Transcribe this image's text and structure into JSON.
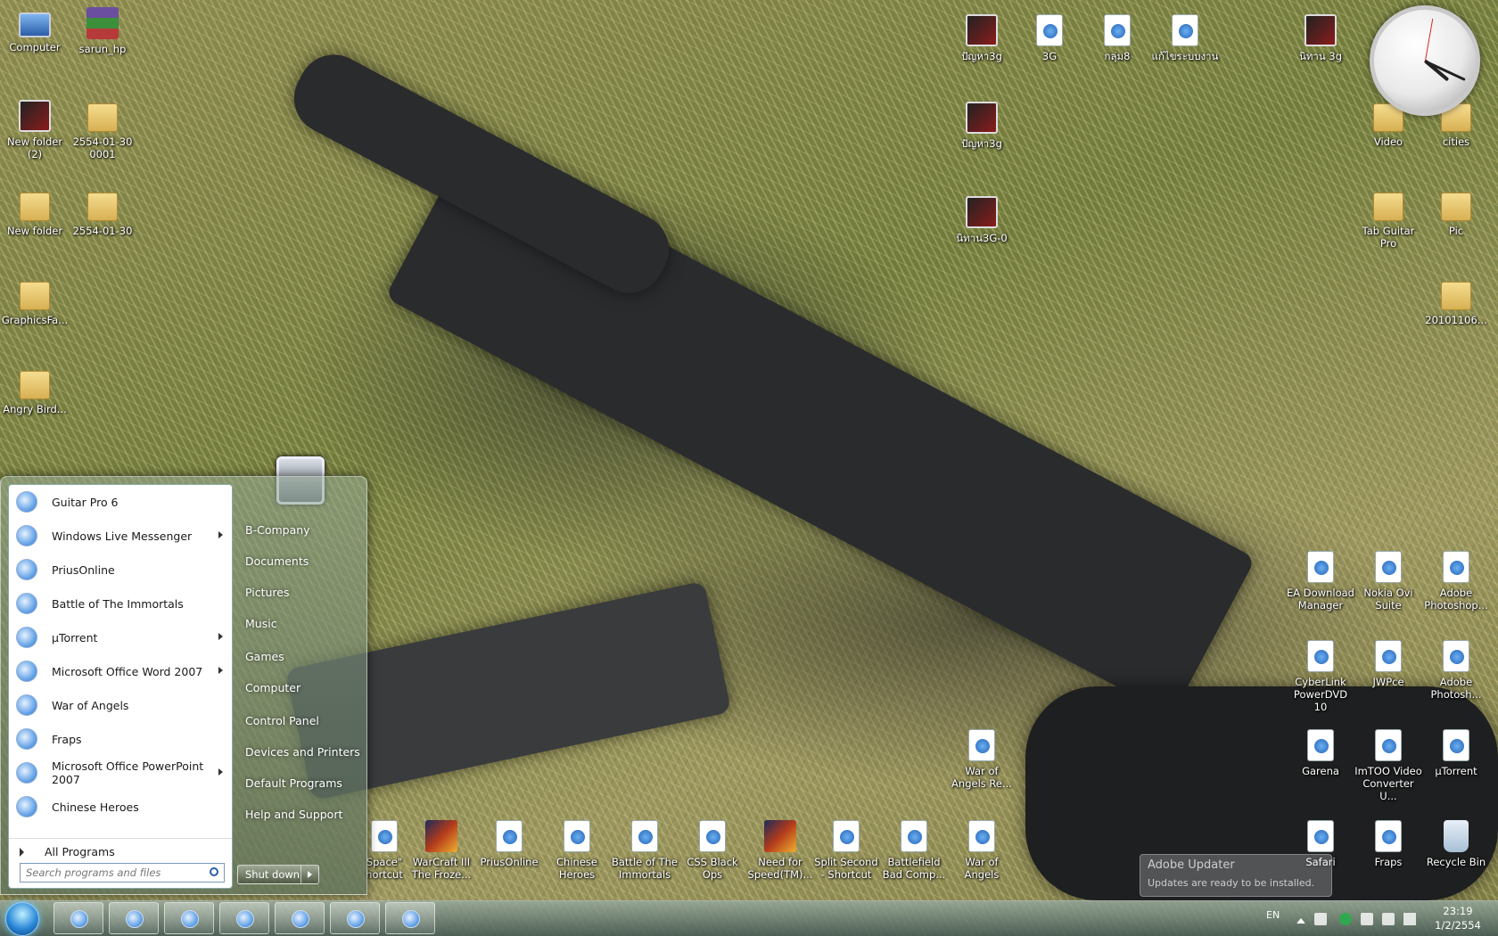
{
  "desktop": {
    "icons_left": [
      {
        "label": "Computer",
        "icon": "computer-icon"
      },
      {
        "label": "sarun_hp",
        "icon": "winrar-archive-icon"
      },
      {
        "label": "New folder (2)",
        "icon": "image-thumbnail-icon"
      },
      {
        "label": "2554-01-30 0001",
        "icon": "folder-icon"
      },
      {
        "label": "New folder",
        "icon": "folder-icon"
      },
      {
        "label": "2554-01-30",
        "icon": "folder-icon"
      },
      {
        "label": "GraphicsFa...",
        "icon": "folder-icon"
      },
      {
        "label": "Angry Bird...",
        "icon": "folder-icon"
      }
    ],
    "icons_top": [
      {
        "label": "ปัญหา3g",
        "icon": "image-thumbnail-icon"
      },
      {
        "label": "3G",
        "icon": "document-icon"
      },
      {
        "label": "กลุ่ม8",
        "icon": "document-icon"
      },
      {
        "label": "แก้ไขระบบงาน",
        "icon": "document-icon"
      },
      {
        "label": "นิทาน 3g",
        "icon": "image-thumbnail-icon"
      },
      {
        "label": "ปัญหา3g",
        "icon": "image-thumbnail-icon"
      },
      {
        "label": "นิทาน3G-0",
        "icon": "image-thumbnail-icon"
      }
    ],
    "icons_right": [
      {
        "label": "Video",
        "icon": "folder-icon"
      },
      {
        "label": "cities",
        "icon": "folder-icon"
      },
      {
        "label": "Tab Guitar Pro",
        "icon": "folder-icon"
      },
      {
        "label": "Pic",
        "icon": "folder-icon"
      },
      {
        "label": "20101106...",
        "icon": "folder-icon"
      },
      {
        "label": "EA Download Manager",
        "icon": "shortcut-icon"
      },
      {
        "label": "Nokia Ovi Suite",
        "icon": "shortcut-icon"
      },
      {
        "label": "Adobe Photoshop...",
        "icon": "shortcut-icon"
      },
      {
        "label": "CyberLink PowerDVD 10",
        "icon": "shortcut-icon"
      },
      {
        "label": "JWPce",
        "icon": "shortcut-icon"
      },
      {
        "label": "Adobe Photosh...",
        "icon": "shortcut-icon"
      },
      {
        "label": "Garena",
        "icon": "shortcut-icon"
      },
      {
        "label": "ImTOO Video Converter U...",
        "icon": "shortcut-icon"
      },
      {
        "label": "µTorrent",
        "icon": "shortcut-icon"
      },
      {
        "label": "War of Angels Re...",
        "icon": "shortcut-icon"
      },
      {
        "label": "Safari",
        "icon": "shortcut-icon"
      },
      {
        "label": "Fraps",
        "icon": "shortcut-icon"
      },
      {
        "label": "Recycle Bin",
        "icon": "recycle-bin-icon"
      }
    ],
    "icons_bottom": [
      {
        "label": "Space\" hortcut",
        "icon": "shortcut-icon"
      },
      {
        "label": "WarCraft III The Froze...",
        "icon": "game-icon"
      },
      {
        "label": "PriusOnline",
        "icon": "shortcut-icon"
      },
      {
        "label": "Chinese Heroes",
        "icon": "shortcut-icon"
      },
      {
        "label": "Battle of The Immortals",
        "icon": "shortcut-icon"
      },
      {
        "label": "CSS Black Ops",
        "icon": "shortcut-icon"
      },
      {
        "label": "Need for Speed(TM)...",
        "icon": "game-icon"
      },
      {
        "label": "Split Second - Shortcut",
        "icon": "shortcut-icon"
      },
      {
        "label": "Battlefield Bad Comp...",
        "icon": "shortcut-icon"
      },
      {
        "label": "War of Angels",
        "icon": "shortcut-icon"
      }
    ]
  },
  "start_menu": {
    "programs": [
      {
        "label": "Guitar Pro 6",
        "submenu": false
      },
      {
        "label": "Windows Live Messenger",
        "submenu": true
      },
      {
        "label": "PriusOnline",
        "submenu": false
      },
      {
        "label": "Battle of The Immortals",
        "submenu": false
      },
      {
        "label": "µTorrent",
        "submenu": true
      },
      {
        "label": "Microsoft Office Word 2007",
        "submenu": true
      },
      {
        "label": "War of Angels",
        "submenu": false
      },
      {
        "label": "Fraps",
        "submenu": false
      },
      {
        "label": "Microsoft Office PowerPoint 2007",
        "submenu": true
      },
      {
        "label": "Chinese Heroes",
        "submenu": false
      }
    ],
    "all_programs": "All Programs",
    "search_placeholder": "Search programs and files",
    "places": [
      "B-Company",
      "Documents",
      "Pictures",
      "Music",
      "Games",
      "Computer",
      "Control Panel",
      "Devices and Printers",
      "Default Programs",
      "Help and Support"
    ],
    "shutdown": "Shut down"
  },
  "notification": {
    "title": "Adobe Updater",
    "message": "Updates are ready to be installed."
  },
  "taskbar": {
    "language": "EN",
    "time": "23:19",
    "date": "1/2/2554"
  }
}
